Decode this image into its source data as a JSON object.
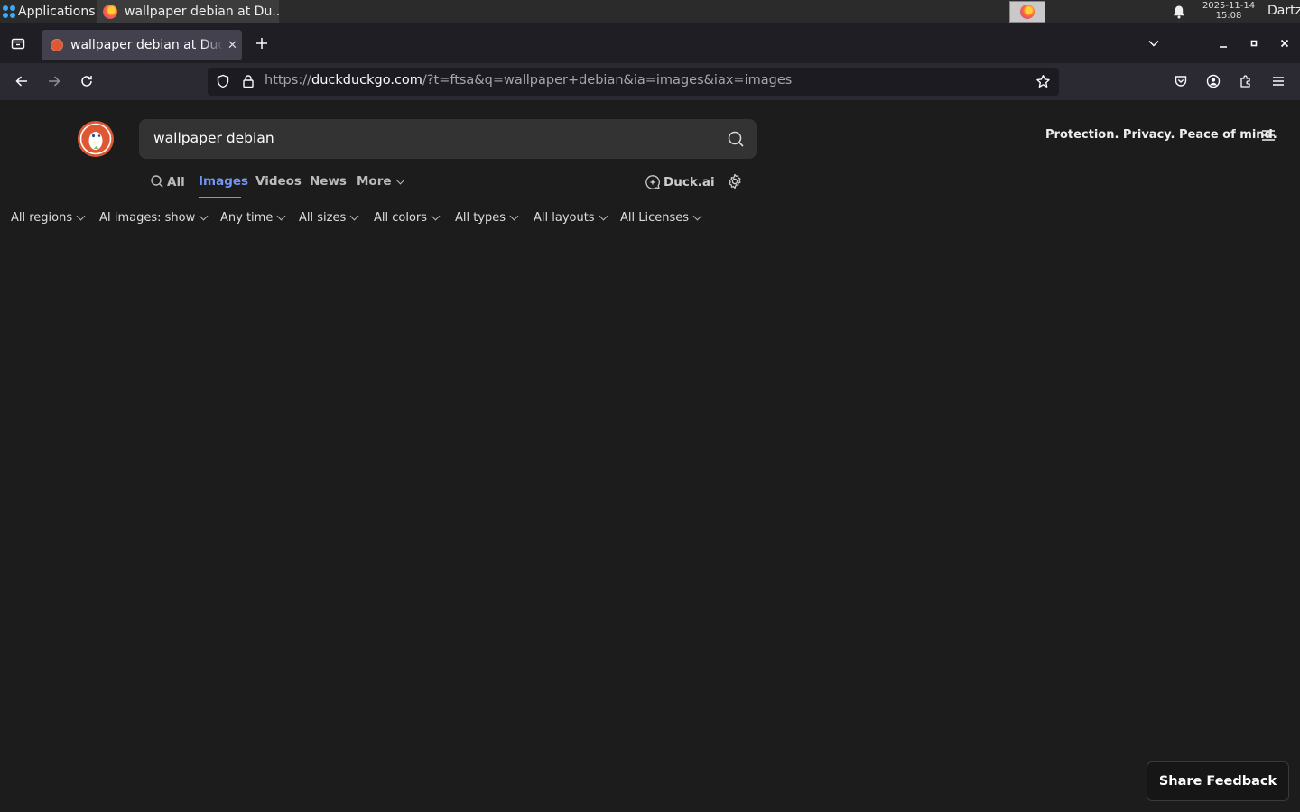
{
  "taskbar": {
    "applications_label": "Applications",
    "window_title": "wallpaper debian at Du...",
    "clock_date": "2025-11-14",
    "clock_time": "15:08",
    "user": "Dartz"
  },
  "browser": {
    "tab_title": "wallpaper debian at DuckDuckGo",
    "url_scheme": "https://",
    "url_host": "duckduckgo.com",
    "url_path": "/?t=ftsa&q=wallpaper+debian&ia=images&iax=images"
  },
  "ddg": {
    "search_query": "wallpaper debian",
    "tagline": "Protection. Privacy. Peace of mind.",
    "tabs": {
      "all": "All",
      "images": "Images",
      "videos": "Videos",
      "news": "News",
      "more": "More"
    },
    "duckai": "Duck.ai",
    "filters": {
      "regions": "All regions",
      "ai_images": "AI images: show",
      "time": "Any time",
      "sizes": "All sizes",
      "colors": "All colors",
      "types": "All types",
      "layouts": "All layouts",
      "licenses": "All Licenses"
    },
    "share_feedback": "Share Feedback"
  },
  "colors": {
    "accent": "#7295f6",
    "ddg_orange": "#de5833",
    "page_bg": "#1c1c1c"
  }
}
